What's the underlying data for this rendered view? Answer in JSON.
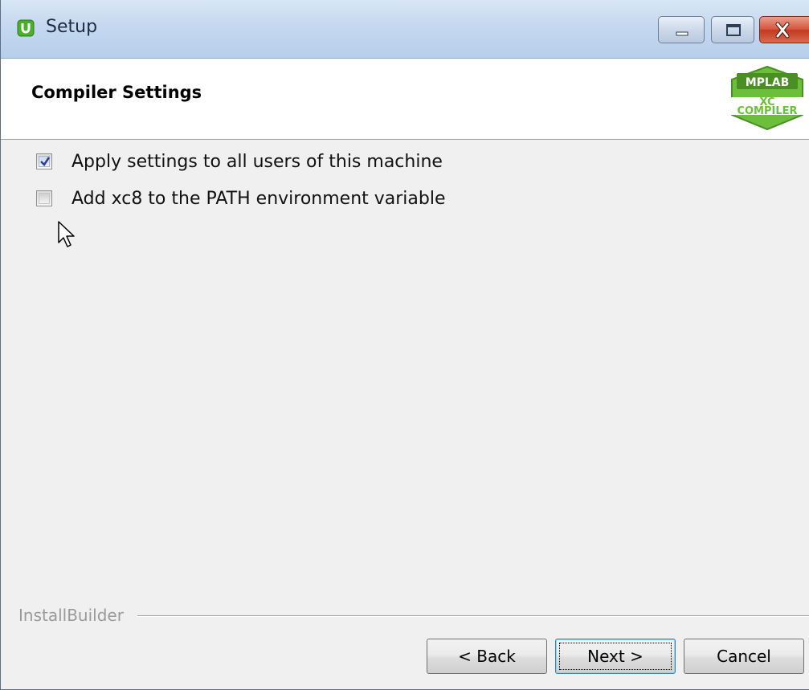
{
  "window": {
    "title": "Setup",
    "controls": {
      "minimize": "minimize-icon",
      "maximize": "maximize-icon",
      "close": "close-icon"
    }
  },
  "header": {
    "page_title": "Compiler Settings",
    "logo": {
      "top_text": "MPLAB",
      "middle_text": "XC",
      "bottom_text": "COMPILER",
      "color": "#6cbf3a"
    }
  },
  "options": [
    {
      "label": "Apply settings to all users of this machine",
      "checked": true
    },
    {
      "label": "Add xc8 to the PATH environment variable",
      "checked": false
    }
  ],
  "footer": {
    "brand": "InstallBuilder",
    "buttons": {
      "back": "< Back",
      "next": "Next >",
      "cancel": "Cancel"
    }
  },
  "colors": {
    "titlebar": "#c4d8f0",
    "close_button": "#c23a20",
    "dialog_bg": "#f0f0f0",
    "focus_border": "#3c7fb1"
  }
}
